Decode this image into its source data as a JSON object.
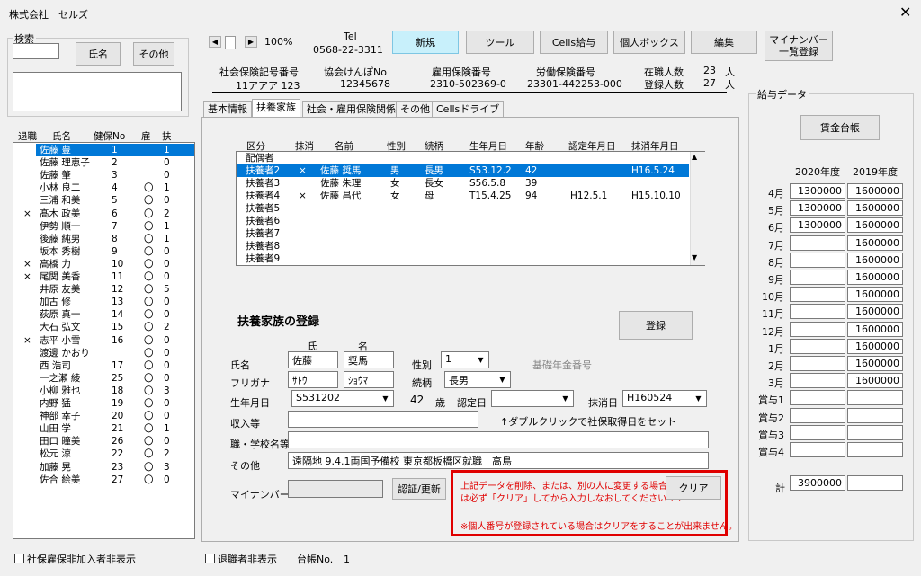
{
  "window": {
    "title": "株式会社　セルズ",
    "close_icon": "close-icon"
  },
  "search": {
    "group_label": "検索",
    "name_button": "氏名",
    "other_button": "その他"
  },
  "emp_list": {
    "headers": [
      "退職",
      "氏名",
      "健保No",
      "雇",
      "扶"
    ],
    "rows": [
      {
        "ret": "",
        "name": "佐藤 豊",
        "no": "1",
        "koyo": "",
        "fu": "1"
      },
      {
        "ret": "",
        "name": "佐藤 理恵子",
        "no": "2",
        "koyo": "",
        "fu": "0"
      },
      {
        "ret": "",
        "name": "佐藤 肇",
        "no": "3",
        "koyo": "",
        "fu": "0"
      },
      {
        "ret": "",
        "name": "小林 良二",
        "no": "4",
        "koyo": "〇",
        "fu": "1"
      },
      {
        "ret": "",
        "name": "三浦 和美",
        "no": "5",
        "koyo": "〇",
        "fu": "0"
      },
      {
        "ret": "×",
        "name": "髙木 政美",
        "no": "6",
        "koyo": "〇",
        "fu": "2"
      },
      {
        "ret": "",
        "name": "伊勢 順一",
        "no": "7",
        "koyo": "〇",
        "fu": "1"
      },
      {
        "ret": "",
        "name": "後藤 純男",
        "no": "8",
        "koyo": "〇",
        "fu": "1"
      },
      {
        "ret": "",
        "name": "坂本 秀樹",
        "no": "9",
        "koyo": "〇",
        "fu": "0"
      },
      {
        "ret": "×",
        "name": "高橋 力",
        "no": "10",
        "koyo": "〇",
        "fu": "0"
      },
      {
        "ret": "×",
        "name": "尾関 美香",
        "no": "11",
        "koyo": "〇",
        "fu": "0"
      },
      {
        "ret": "",
        "name": "井原 友美",
        "no": "12",
        "koyo": "〇",
        "fu": "5"
      },
      {
        "ret": "",
        "name": "加古 修",
        "no": "13",
        "koyo": "〇",
        "fu": "0"
      },
      {
        "ret": "",
        "name": "荻原 真一",
        "no": "14",
        "koyo": "〇",
        "fu": "0"
      },
      {
        "ret": "",
        "name": "大石 弘文",
        "no": "15",
        "koyo": "〇",
        "fu": "2"
      },
      {
        "ret": "×",
        "name": "志平 小雪",
        "no": "16",
        "koyo": "〇",
        "fu": "0"
      },
      {
        "ret": "",
        "name": "渡邊 かおり",
        "no": "",
        "koyo": "〇",
        "fu": "0"
      },
      {
        "ret": "",
        "name": "西 浩司",
        "no": "17",
        "koyo": "〇",
        "fu": "0"
      },
      {
        "ret": "",
        "name": "一之瀬 綾",
        "no": "25",
        "koyo": "〇",
        "fu": "0"
      },
      {
        "ret": "",
        "name": "小柳 雅也",
        "no": "18",
        "koyo": "〇",
        "fu": "3"
      },
      {
        "ret": "",
        "name": "内野 猛",
        "no": "19",
        "koyo": "〇",
        "fu": "0"
      },
      {
        "ret": "",
        "name": "神部 幸子",
        "no": "20",
        "koyo": "〇",
        "fu": "0"
      },
      {
        "ret": "",
        "name": "山田 学",
        "no": "21",
        "koyo": "〇",
        "fu": "1"
      },
      {
        "ret": "",
        "name": "田口 瞳美",
        "no": "26",
        "koyo": "〇",
        "fu": "0"
      },
      {
        "ret": "",
        "name": "松元 涼",
        "no": "22",
        "koyo": "〇",
        "fu": "2"
      },
      {
        "ret": "",
        "name": "加藤 晃",
        "no": "23",
        "koyo": "〇",
        "fu": "3"
      },
      {
        "ret": "",
        "name": "佐合 絵美",
        "no": "27",
        "koyo": "〇",
        "fu": "0"
      }
    ]
  },
  "footer": {
    "hide_uninsured": "社保雇保非加入者非表示",
    "hide_retired": "退職者非表示",
    "ledger_label": "台帳No.",
    "ledger_no": "1"
  },
  "toolbar": {
    "zoom": "100%",
    "tel_label": "Tel",
    "tel": "0568-22-3311",
    "new": "新規",
    "tools": "ツール",
    "cells_pay": "Cells給与",
    "personal_box": "個人ボックス",
    "edit": "編集",
    "mynumber_list_l1": "マイナンバー",
    "mynumber_list_l2": "一覧登録"
  },
  "company": {
    "labels": [
      "社会保険記号番号",
      "協会けんぽNo",
      "雇用保険番号",
      "労働保険番号"
    ],
    "values": [
      "11アアア 123",
      "12345678",
      "2310-502369-0",
      "23301-442253-000"
    ],
    "enrolled_label": "在職人数",
    "enrolled": "23",
    "registered_label": "登録人数",
    "registered": "27",
    "unit": "人"
  },
  "tabs": [
    "基本情報",
    "扶養家族",
    "社会・雇用保険関係",
    "その他",
    "Cellsドライブ"
  ],
  "dep_table": {
    "headers": [
      "区分",
      "抹消",
      "名前",
      "性別",
      "続柄",
      "生年月日",
      "年齢",
      "認定年月日",
      "抹消年月日"
    ],
    "rows": [
      {
        "k": "配偶者",
        "m": "",
        "n": "",
        "s": "",
        "z": "",
        "b": "",
        "a": "",
        "r": "",
        "e": ""
      },
      {
        "k": "扶養者2",
        "m": "×",
        "n": "佐藤 奨馬",
        "s": "男",
        "z": "長男",
        "b": "S53.12.2",
        "a": "42",
        "r": "",
        "e": "H16.5.24"
      },
      {
        "k": "扶養者3",
        "m": "",
        "n": "佐藤 朱理",
        "s": "女",
        "z": "長女",
        "b": "S56.5.8",
        "a": "39",
        "r": "",
        "e": ""
      },
      {
        "k": "扶養者4",
        "m": "×",
        "n": "佐藤 昌代",
        "s": "女",
        "z": "母",
        "b": "T15.4.25",
        "a": "94",
        "r": "H12.5.1",
        "e": "H15.10.10"
      },
      {
        "k": "扶養者5",
        "m": "",
        "n": "",
        "s": "",
        "z": "",
        "b": "",
        "a": "",
        "r": "",
        "e": ""
      },
      {
        "k": "扶養者6",
        "m": "",
        "n": "",
        "s": "",
        "z": "",
        "b": "",
        "a": "",
        "r": "",
        "e": ""
      },
      {
        "k": "扶養者7",
        "m": "",
        "n": "",
        "s": "",
        "z": "",
        "b": "",
        "a": "",
        "r": "",
        "e": ""
      },
      {
        "k": "扶養者8",
        "m": "",
        "n": "",
        "s": "",
        "z": "",
        "b": "",
        "a": "",
        "r": "",
        "e": ""
      },
      {
        "k": "扶養者9",
        "m": "",
        "n": "",
        "s": "",
        "z": "",
        "b": "",
        "a": "",
        "r": "",
        "e": ""
      }
    ]
  },
  "form": {
    "title": "扶養家族の登録",
    "register": "登録",
    "sei_label": "氏",
    "mei_label": "名",
    "name_label": "氏名",
    "sei": "佐藤",
    "mei": "奨馬",
    "kana_label": "フリガナ",
    "kana_sei": "ｻﾄｳ",
    "kana_mei": "ｼｮｳﾏ",
    "gender_label": "性別",
    "gender": "1",
    "pension_label": "基礎年金番号",
    "relation_label": "続柄",
    "relation": "長男",
    "birth_label": "生年月日",
    "birth": "S531202",
    "age": "42",
    "age_unit": "歳",
    "cert_label": "認定日",
    "cert": "",
    "erase_label": "抹消日",
    "erase": "H160524",
    "income_label": "収入等",
    "dblclick_hint": "↑ダブルクリックで社保取得日をセット",
    "job_label": "職・学校名等",
    "job": "",
    "other_label": "その他",
    "other": "遠隔地 9.4.1両国予備校 東京都板橋区就職　高島",
    "mynumber_label": "マイナンバー",
    "verify_button": "認証/更新",
    "warn1": "上記データを削除、または、別の人に変更する場合",
    "warn2": "は必ず「クリア」してから入力しなおしてください⇒⇒",
    "warn3": "※個人番号が登録されている場合はクリアをすることが出来ません。",
    "clear_button": "クリア"
  },
  "salary": {
    "group_label": "給与データ",
    "ledger_button": "賃金台帳",
    "col1": "2020年度",
    "col2": "2019年度",
    "rows": [
      {
        "m": "4月",
        "a": "1300000",
        "b": "1600000"
      },
      {
        "m": "5月",
        "a": "1300000",
        "b": "1600000"
      },
      {
        "m": "6月",
        "a": "1300000",
        "b": "1600000"
      },
      {
        "m": "7月",
        "a": "",
        "b": "1600000"
      },
      {
        "m": "8月",
        "a": "",
        "b": "1600000"
      },
      {
        "m": "9月",
        "a": "",
        "b": "1600000"
      },
      {
        "m": "10月",
        "a": "",
        "b": "1600000"
      },
      {
        "m": "11月",
        "a": "",
        "b": "1600000"
      },
      {
        "m": "12月",
        "a": "",
        "b": "1600000"
      },
      {
        "m": "1月",
        "a": "",
        "b": "1600000"
      },
      {
        "m": "2月",
        "a": "",
        "b": "1600000"
      },
      {
        "m": "3月",
        "a": "",
        "b": "1600000"
      },
      {
        "m": "賞与1",
        "a": "",
        "b": ""
      },
      {
        "m": "賞与2",
        "a": "",
        "b": ""
      },
      {
        "m": "賞与3",
        "a": "",
        "b": ""
      },
      {
        "m": "賞与4",
        "a": "",
        "b": ""
      }
    ],
    "total_label": "計",
    "total": "3900000",
    "total2": ""
  }
}
